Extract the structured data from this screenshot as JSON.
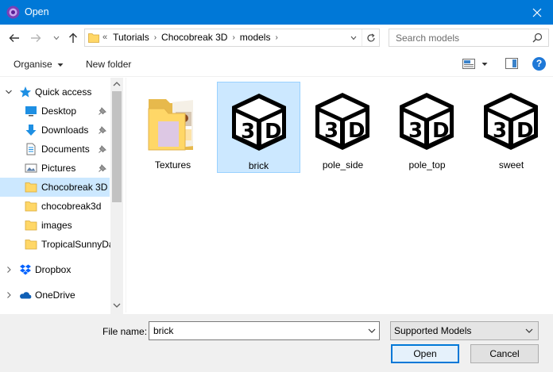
{
  "window": {
    "title": "Open"
  },
  "address": {
    "lead": "«",
    "crumbs": [
      "Tutorials",
      "Chocobreak 3D",
      "models"
    ]
  },
  "search": {
    "placeholder": "Search models"
  },
  "toolbar": {
    "organise": "Organise",
    "new_folder": "New folder",
    "help": "?"
  },
  "nav": {
    "items": [
      {
        "label": "Quick access",
        "icon": "star-icon"
      },
      {
        "label": "Desktop",
        "icon": "desktop-icon",
        "pinned": true
      },
      {
        "label": "Downloads",
        "icon": "download-icon",
        "pinned": true
      },
      {
        "label": "Documents",
        "icon": "documents-icon",
        "pinned": true
      },
      {
        "label": "Pictures",
        "icon": "pictures-icon",
        "pinned": true
      },
      {
        "label": "Chocobreak 3D",
        "icon": "folder-icon",
        "selected": true
      },
      {
        "label": "chocobreak3d",
        "icon": "folder-icon"
      },
      {
        "label": "images",
        "icon": "folder-icon"
      },
      {
        "label": "TropicalSunnyDa",
        "icon": "folder-icon"
      },
      {
        "label": "Dropbox",
        "icon": "dropbox-icon"
      },
      {
        "label": "OneDrive",
        "icon": "onedrive-icon"
      }
    ]
  },
  "files": [
    {
      "name": "Textures",
      "type": "folder"
    },
    {
      "name": "brick",
      "type": "3d-model",
      "selected": true
    },
    {
      "name": "pole_side",
      "type": "3d-model"
    },
    {
      "name": "pole_top",
      "type": "3d-model"
    },
    {
      "name": "sweet",
      "type": "3d-model"
    }
  ],
  "footer": {
    "file_name_label": "File name:",
    "file_name_value": "brick",
    "file_type": "Supported Models",
    "open_label": "Open",
    "cancel_label": "Cancel"
  },
  "colors": {
    "titlebar": "#0078d7",
    "selection": "#cce8ff",
    "folder": "#ffd767"
  }
}
